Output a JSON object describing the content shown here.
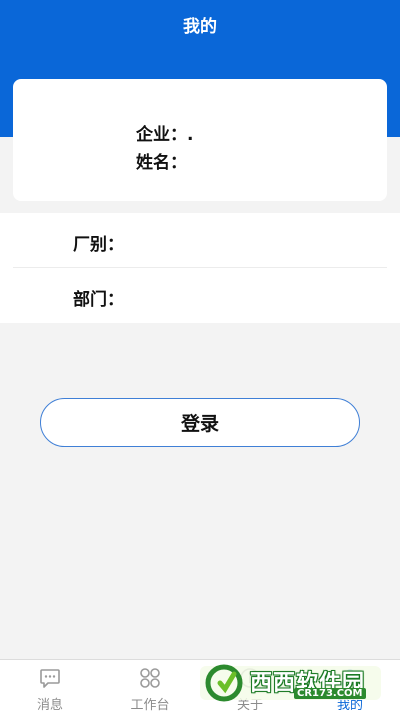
{
  "header": {
    "title": "我的"
  },
  "profile": {
    "company_label": "企业：.",
    "name_label": "姓名："
  },
  "info_rows": [
    {
      "label": "厂别："
    },
    {
      "label": "部门："
    }
  ],
  "actions": {
    "login_label": "登录"
  },
  "tabbar": {
    "tabs": [
      {
        "label": "消息",
        "icon": "message-icon",
        "active": false
      },
      {
        "label": "工作台",
        "icon": "grid-icon",
        "active": false
      },
      {
        "label": "关于",
        "icon": "info-icon",
        "active": false
      },
      {
        "label": "我的",
        "icon": "user-icon",
        "active": true
      }
    ]
  },
  "watermark": {
    "text": "西西软件园",
    "sub": "CR173.COM"
  },
  "colors": {
    "primary": "#0a67d8",
    "background": "#f3f3f3",
    "inactive_tab": "#8c8c8c"
  }
}
